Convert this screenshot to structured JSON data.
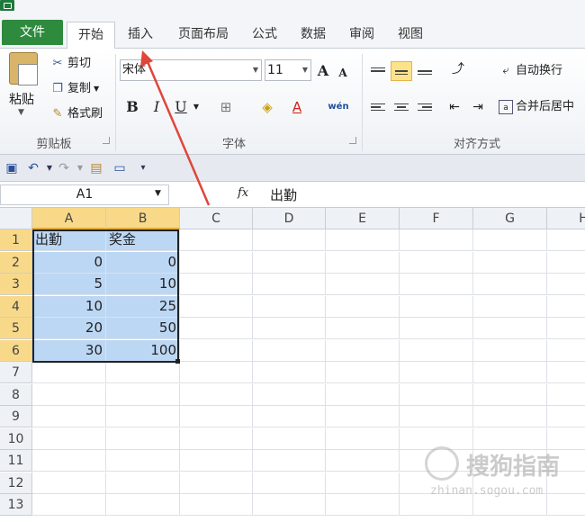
{
  "tabs": [
    "文件",
    "开始",
    "插入",
    "页面布局",
    "公式",
    "数据",
    "审阅",
    "视图"
  ],
  "clipboard": {
    "paste": "粘贴",
    "cut": "剪切",
    "copy": "复制",
    "format_painter": "格式刷",
    "label": "剪贴板"
  },
  "font": {
    "name": "宋体",
    "size": "11",
    "bold": "B",
    "italic": "I",
    "underline": "U",
    "label": "字体",
    "wen": "wén"
  },
  "alignment": {
    "wrap_text": "自动换行",
    "merge_center": "合并后居中",
    "label": "对齐方式"
  },
  "formula_bar": {
    "name_box": "A1",
    "fx": "fx",
    "content": "出勤"
  },
  "columns": [
    "A",
    "B",
    "C",
    "D",
    "E",
    "F",
    "G",
    "H"
  ],
  "rows": [
    "1",
    "2",
    "3",
    "4",
    "5",
    "6",
    "7",
    "8",
    "9",
    "10",
    "11",
    "12",
    "13"
  ],
  "sheet": {
    "headers": [
      "出勤",
      "奖金"
    ],
    "data": [
      [
        "0",
        "0"
      ],
      [
        "5",
        "10"
      ],
      [
        "10",
        "25"
      ],
      [
        "20",
        "50"
      ],
      [
        "30",
        "100"
      ]
    ]
  },
  "watermark": {
    "text": "搜狗指南",
    "url": "zhinan.sogou.com"
  },
  "colors": {
    "selection": "#bcd7f4",
    "file_tab": "#2e8b3e",
    "arrow": "#e0463a"
  }
}
